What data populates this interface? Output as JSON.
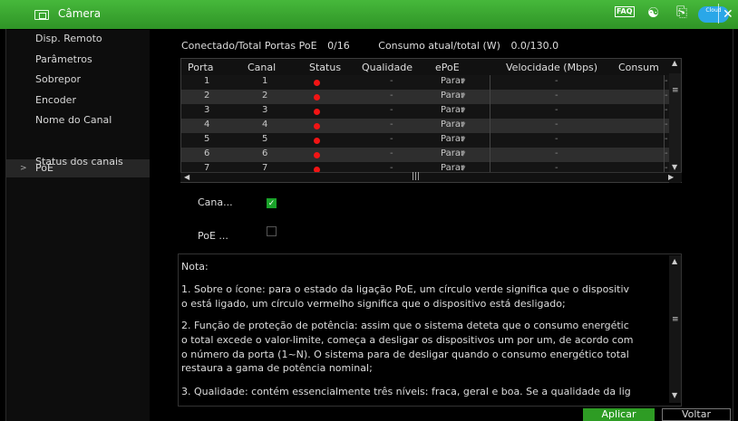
{
  "window": {
    "title": "Câmera",
    "faq": "FAQ",
    "cloud_label": "Cloud"
  },
  "sidebar": {
    "items": [
      {
        "label": "Disp. Remoto"
      },
      {
        "label": "Parâmetros"
      },
      {
        "label": "Sobrepor"
      },
      {
        "label": "Encoder"
      },
      {
        "label": "Nome do Canal"
      },
      {
        "label": "PoE",
        "active": true
      },
      {
        "label": "Status dos canais"
      }
    ]
  },
  "summary": {
    "connected_label": "Conectado/Total Portas PoE",
    "connected_value": "0/16",
    "consumption_label": "Consumo atual/total (W)",
    "consumption_value": "0.0/130.0"
  },
  "table": {
    "columns": [
      "Porta",
      "Canal",
      "Status",
      "Qualidade",
      "ePoE",
      "Velocidade (Mbps)",
      "Consum"
    ],
    "rows": [
      {
        "porta": "1",
        "canal": "1",
        "qualidade": "-",
        "epoe": "Parar",
        "velocidade": "-",
        "consumo": "-"
      },
      {
        "porta": "2",
        "canal": "2",
        "qualidade": "-",
        "epoe": "Parar",
        "velocidade": "-",
        "consumo": "-"
      },
      {
        "porta": "3",
        "canal": "3",
        "qualidade": "-",
        "epoe": "Parar",
        "velocidade": "-",
        "consumo": "-"
      },
      {
        "porta": "4",
        "canal": "4",
        "qualidade": "-",
        "epoe": "Parar",
        "velocidade": "-",
        "consumo": "-"
      },
      {
        "porta": "5",
        "canal": "5",
        "qualidade": "-",
        "epoe": "Parar",
        "velocidade": "-",
        "consumo": "-"
      },
      {
        "porta": "6",
        "canal": "6",
        "qualidade": "-",
        "epoe": "Parar",
        "velocidade": "-",
        "consumo": "-"
      },
      {
        "porta": "7",
        "canal": "7",
        "qualidade": "-",
        "epoe": "Parar",
        "velocidade": "-",
        "consumo": "-"
      }
    ],
    "status_color": "#f21414"
  },
  "options": {
    "channel_label": "Cana...",
    "channel_checked": true,
    "poe_label": "PoE ...",
    "poe_checked": false
  },
  "note": {
    "title": "Nota:",
    "lines": [
      "1. Sobre o ícone: para o estado da ligação PoE, um círculo verde significa que o dispositiv",
      "o está ligado, um círculo vermelho significa que o dispositivo está desligado;",
      "2. Função de proteção de potência: assim que o sistema deteta que o consumo energétic",
      "o total excede o valor-limite, começa a desligar os dispositivos um por um, de acordo com",
      "o número da porta (1~N). O sistema para de desligar quando o consumo energético total",
      "restaura a gama de potência nominal;",
      "3. Qualidade: contém essencialmente três níveis: fraca, geral e boa. Se a qualidade da lig"
    ]
  },
  "buttons": {
    "apply": "Aplicar",
    "back": "Voltar"
  },
  "colors": {
    "accent": "#3aa830",
    "active_row": "#262626"
  }
}
